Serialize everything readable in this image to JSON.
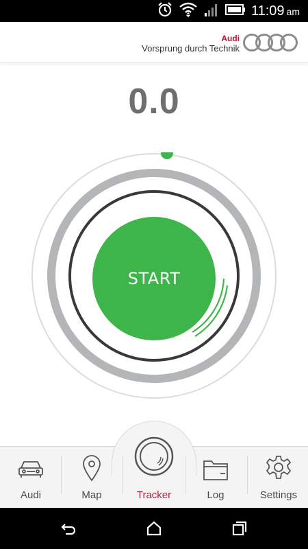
{
  "status_bar": {
    "time": "11:09",
    "ampm": "am",
    "icons": [
      "alarm-icon",
      "wifi-icon",
      "signal-icon",
      "battery-icon"
    ]
  },
  "header": {
    "brand": "Audi",
    "slogan": "Vorsprung durch Technik",
    "logo": "audi-rings-logo"
  },
  "tracker": {
    "speed": "0.0",
    "start_label": "START"
  },
  "tabs": [
    {
      "label": "Audi",
      "icon": "car-icon",
      "active": false
    },
    {
      "label": "Map",
      "icon": "map-pin-icon",
      "active": false
    },
    {
      "label": "Tracker",
      "icon": "tracker-dial-icon",
      "active": true
    },
    {
      "label": "Log",
      "icon": "folder-icon",
      "active": false
    },
    {
      "label": "Settings",
      "icon": "gear-icon",
      "active": false
    }
  ],
  "nav_bar": {
    "buttons": [
      "back-icon",
      "home-icon",
      "recent-apps-icon"
    ]
  },
  "colors": {
    "accent_green": "#3db54a",
    "brand_red": "#c8102e",
    "active_tab_label": "#b5203a",
    "speed_text": "#6d6f71",
    "ring_grey": "#b3b5b7",
    "ring_dark": "#37393c"
  }
}
